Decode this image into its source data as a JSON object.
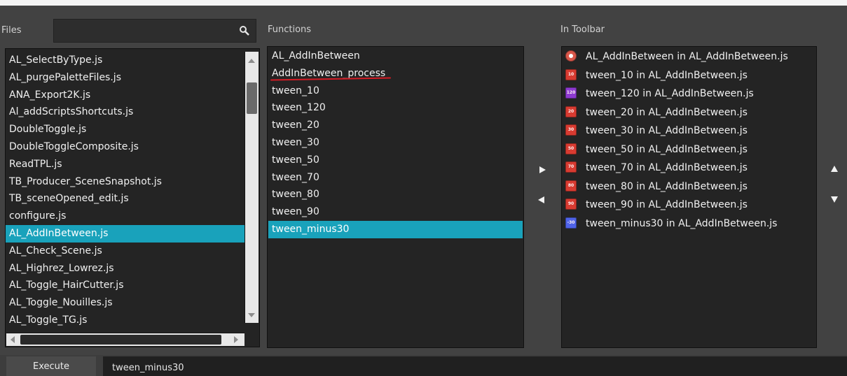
{
  "files": {
    "label": "Files",
    "search": {
      "value": "",
      "placeholder": ""
    },
    "items": [
      {
        "label": "AL_SelectByType.js"
      },
      {
        "label": "AL_purgePaletteFiles.js"
      },
      {
        "label": "ANA_Export2K.js"
      },
      {
        "label": "Al_addScriptsShortcuts.js"
      },
      {
        "label": "DoubleToggle.js"
      },
      {
        "label": "DoubleToggleComposite.js"
      },
      {
        "label": "ReadTPL.js"
      },
      {
        "label": "TB_Producer_SceneSnapshot.js"
      },
      {
        "label": "TB_sceneOpened_edit.js"
      },
      {
        "label": "configure.js"
      },
      {
        "label": "AL_AddInBetween.js",
        "selected": true
      },
      {
        "label": "AL_Check_Scene.js"
      },
      {
        "label": "AL_Highrez_Lowrez.js"
      },
      {
        "label": "AL_Toggle_HairCutter.js"
      },
      {
        "label": "AL_Toggle_Nouilles.js"
      },
      {
        "label": "AL_Toggle_TG.js"
      }
    ]
  },
  "functions": {
    "label": "Functions",
    "items": [
      {
        "label": "AL_AddInBetween"
      },
      {
        "label": "AddInBetween_process",
        "underlined": true
      },
      {
        "label": "tween_10"
      },
      {
        "label": "tween_120"
      },
      {
        "label": "tween_20"
      },
      {
        "label": "tween_30"
      },
      {
        "label": "tween_50"
      },
      {
        "label": "tween_70"
      },
      {
        "label": "tween_80"
      },
      {
        "label": "tween_90"
      },
      {
        "label": "tween_minus30",
        "selected": true
      }
    ]
  },
  "toolbar": {
    "label": "In Toolbar",
    "items": [
      {
        "label": "AL_AddInBetween in AL_AddInBetween.js",
        "icon": "addinbetween-icon",
        "icon_text": "",
        "color": "#d9574a",
        "shape": "badge"
      },
      {
        "label": "tween_10 in AL_AddInBetween.js",
        "icon": "tween-10-icon",
        "icon_text": "10",
        "color": "#d83b31",
        "shape": "square"
      },
      {
        "label": "tween_120 in AL_AddInBetween.js",
        "icon": "tween-120-icon",
        "icon_text": "120",
        "color": "#8e3ad0",
        "shape": "square"
      },
      {
        "label": "tween_20 in AL_AddInBetween.js",
        "icon": "tween-20-icon",
        "icon_text": "20",
        "color": "#d83b31",
        "shape": "square"
      },
      {
        "label": "tween_30 in AL_AddInBetween.js",
        "icon": "tween-30-icon",
        "icon_text": "30",
        "color": "#d83b31",
        "shape": "square"
      },
      {
        "label": "tween_50 in AL_AddInBetween.js",
        "icon": "tween-50-icon",
        "icon_text": "50",
        "color": "#d83b31",
        "shape": "square"
      },
      {
        "label": "tween_70 in AL_AddInBetween.js",
        "icon": "tween-70-icon",
        "icon_text": "70",
        "color": "#d83b31",
        "shape": "square"
      },
      {
        "label": "tween_80 in AL_AddInBetween.js",
        "icon": "tween-80-icon",
        "icon_text": "80",
        "color": "#d83b31",
        "shape": "square"
      },
      {
        "label": "tween_90 in AL_AddInBetween.js",
        "icon": "tween-90-icon",
        "icon_text": "90",
        "color": "#d83b31",
        "shape": "square"
      },
      {
        "label": "tween_minus30 in AL_AddInBetween.js",
        "icon": "tween-minus30-icon",
        "icon_text": "-30",
        "color": "#4f63e8",
        "shape": "square"
      }
    ]
  },
  "controls": {
    "add_icon": "right-arrow-icon",
    "remove_icon": "left-arrow-icon",
    "move_up_icon": "up-arrow-icon",
    "move_down_icon": "down-arrow-icon"
  },
  "bottom": {
    "execute_label": "Execute",
    "command_value": "tween_minus30"
  },
  "colors": {
    "selection": "#19a2bb",
    "underline_mark": "#d51b24"
  }
}
